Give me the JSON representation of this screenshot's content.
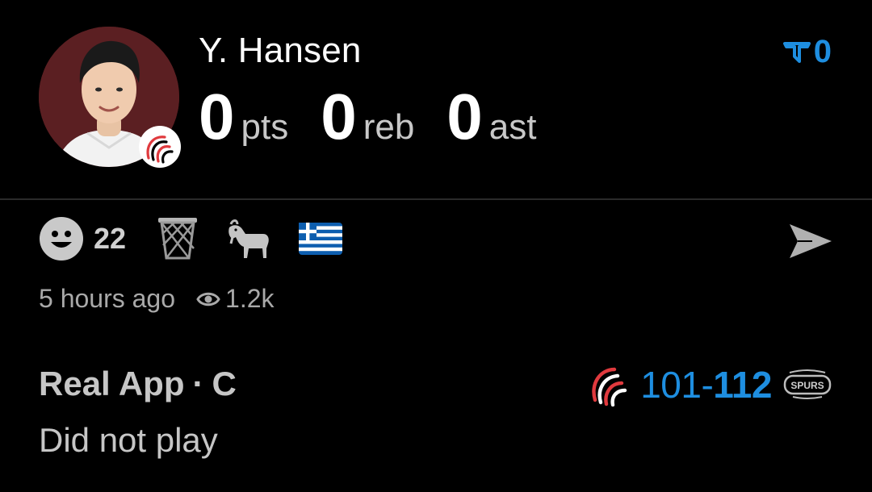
{
  "player": {
    "name": "Y. Hansen",
    "avatar_icon": "player-headshot",
    "team_badge_icon": "trail-blazers-logo"
  },
  "stats": [
    {
      "value": "0",
      "unit": "pts"
    },
    {
      "value": "0",
      "unit": "reb"
    },
    {
      "value": "0",
      "unit": "ast"
    }
  ],
  "filter": {
    "icon": "filter-icon",
    "count": "0",
    "color": "#1e8ee0"
  },
  "reactions": {
    "smiley_count": "22",
    "icons": [
      "smiley-icon",
      "basketball-hoop-icon",
      "goat-icon",
      "greece-flag-icon"
    ]
  },
  "meta": {
    "time_ago": "5 hours ago",
    "views": "1.2k"
  },
  "source": {
    "app": "Real App",
    "separator": "·",
    "position": "C"
  },
  "status": "Did not play",
  "game": {
    "home_icon": "trail-blazers-logo",
    "away_icon": "spurs-logo",
    "home_score": "101",
    "dash": "-",
    "away_score": "112",
    "score_color": "#1e8ee0"
  }
}
